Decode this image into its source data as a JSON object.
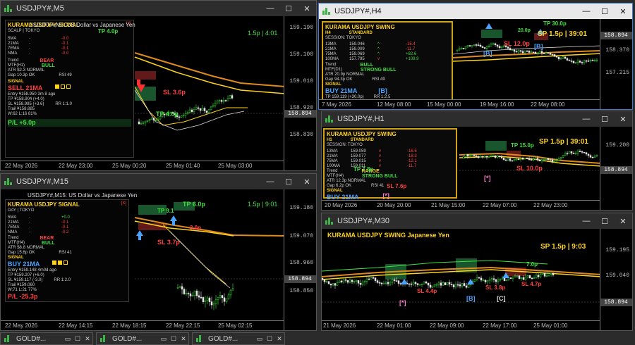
{
  "windows": {
    "m5": {
      "title": "USDJPY#,M5",
      "chart_desc": "USDJPY#,M5:  US Dollar vs Japanese Yen",
      "top_right": "1.5p | 4:01",
      "yticks": [
        "159.190",
        "159.100",
        "159.010",
        "158.920",
        "158.830"
      ],
      "price": "158.894",
      "xticks": [
        "22 May 2026",
        "22 May 23:00",
        "25 May 00:20",
        "25 May 01:40",
        "25 May 03:00"
      ],
      "panel": {
        "title": "KURAMA USDJPY SIGNAL",
        "close_mark": "[X]",
        "session": "SCALP | TOKYO",
        "ma_rows": [
          {
            "name": "5MA",
            "dash": "-",
            "value": "-0.0"
          },
          {
            "name": "21MA",
            "dash": "-",
            "value": "-0.1"
          },
          {
            "name": "7EMA",
            "dash": "-",
            "value": "-0.1"
          },
          {
            "name": "NMA",
            "dash": "-",
            "value": "-0.0"
          }
        ],
        "trend_label": "Trend",
        "trend_value": "BEAR",
        "mtf_label": "MTF(H1)",
        "mtf_value": "BULL",
        "atr": "ATR $2.3 NORMAL",
        "gap": "Gap 10.3p OK",
        "rsi": "RSI 49",
        "signal_label": "SIGNAL",
        "signal_value": "SELL  21MA",
        "entry": "Entry ¥158.950  3m 8 ago",
        "tp": "TP ¥158.904 (+4.0)",
        "sl": "SL ¥158.985 (+3.6)",
        "rr": "RR 1:1.0",
        "trail": "Trail ¥158.885",
        "winloss": "W:62 L:16  81%",
        "pl": "P/L  +5.0p"
      },
      "labels": {
        "tp_top": "TP 4.0p",
        "sl": "SL 3.6p",
        "tp_mid": "TP 4.0p"
      }
    },
    "m15": {
      "title": "USDJPY#,M15",
      "chart_desc": "USDJPY#,M15:  US Dollar vs Japanese Yen",
      "top_right": "1.5p | 9:01",
      "yticks": [
        "159.180",
        "159.070",
        "158.960",
        "158.850"
      ],
      "price": "158.894",
      "xticks": [
        "22 May 2026",
        "22 May 14:15",
        "22 May 18:15",
        "22 May 22:15",
        "25 May 02:15"
      ],
      "panel": {
        "title": "KURAMA USDJPY SIGNAL",
        "close_mark": "[X]",
        "session": "DAY | TOKYO",
        "ma_rows": [
          {
            "name": "5MA",
            "dash": "-",
            "value": "+0.0"
          },
          {
            "name": "21MA",
            "dash": "-",
            "value": "-0.1"
          },
          {
            "name": "7EMA",
            "dash": "-",
            "value": "-0.1"
          },
          {
            "name": "NMA",
            "dash": "-",
            "value": "-0.2"
          }
        ],
        "trend_label": "Trend",
        "trend_value": "BEAR",
        "mtf_label": "MTF(H4)",
        "mtf_value": "BULL",
        "atr": "ATR $8.8 NORMAL",
        "gap": "Gap 15.6p OK",
        "rsi": "RSI 41",
        "signal_label": "SIGNAL",
        "signal_value": "BUY  21MA",
        "entry": "Entry ¥159.148  4m0d ago",
        "tp": "TP ¥159.207 (+6.0)",
        "sl": "SL ¥159.117 (-3.0)",
        "rr": "RR 1:2.0",
        "trail": "Trail ¥159.060",
        "winloss": "W:71 L:21  77%",
        "pl": "P/L  -25.3p"
      },
      "labels": {
        "tp_top": "TP 6.0p",
        "tp_small": "TP 9.1",
        "sl": "SL 3.7p",
        "sl_small": "3.0p"
      }
    },
    "h4": {
      "title": "USDJPY#,H4",
      "top_right": "SP 1.5p  |  39:01",
      "yticks": [
        "158.370",
        "157.215"
      ],
      "price": "158.894",
      "xticks": [
        "7 May 2026",
        "12 May 08:00",
        "15 May 00:00",
        "19 May 16:00",
        "22 May 08:00"
      ],
      "panel": {
        "title": "KURAMA USDJPY SWING",
        "tf": "H4",
        "mode": "STANDARD",
        "session": "SESSION: TOKYO",
        "ma_rows": [
          {
            "name": "13MA",
            "price": "159.046",
            "arrow": "^",
            "value": "-15.4"
          },
          {
            "name": "21MA",
            "price": "159.009",
            "arrow": "^",
            "value": "-11.7"
          },
          {
            "name": "75MA",
            "price": "159.069",
            "arrow": "^",
            "value": "+82.6"
          },
          {
            "name": "100MA",
            "price": "157.795",
            "arrow": "v",
            "value": "+109.9"
          }
        ],
        "trend_label": "Trend",
        "trend_value": "BULL",
        "mtf_label": "MTF(D1)",
        "mtf_value": "STRONG BULL",
        "atr": "ATR 20.9p  NORMAL",
        "gap": "Gap 94.3p OK",
        "rsi": "RSI 49",
        "signal_label": "SIGNAL",
        "signal_value": "BUY  21MA",
        "signal_tag": "[B]",
        "entry": "TP 159.119 (+30.0p)",
        "rr": "RR 1:2.5"
      },
      "labels": {
        "tp": "TP 30.0p",
        "sl": "SL 12.0p",
        "tag1": "[B]",
        "tag2": "[B]",
        "small": "20.0p"
      }
    },
    "h1": {
      "title": "USDJPY#,H1",
      "top_right": "SP 1.5p  |  39:01",
      "yticks": [
        "159.200"
      ],
      "price": "158.894",
      "xticks": [
        "20 May 2026",
        "20 May 20:00",
        "21 May 15:00",
        "22 May 07:00",
        "22 May 23:00"
      ],
      "panel": {
        "title": "KURAMA USDJPY SWING",
        "tf": "H1",
        "mode": "STANDARD",
        "session": "SESSION: TOKYO",
        "ma_rows": [
          {
            "name": "13MA",
            "price": "159.059",
            "arrow": "v",
            "value": "-16.5"
          },
          {
            "name": "21MA",
            "price": "159.077",
            "arrow": "v",
            "value": "-18.3"
          },
          {
            "name": "75MA",
            "price": "159.015",
            "arrow": "v",
            "value": "-12.1"
          },
          {
            "name": "100MA",
            "price": "159.011",
            "arrow": "v",
            "value": "-11.7"
          }
        ],
        "trend_label": "Trend",
        "trend_value": "RANGE",
        "mtf_label": "MTF(H4)",
        "mtf_value": "STRONG BULL",
        "atr": "ATR 12.3p NORMAL",
        "gap": "Gap 6.2p OK",
        "rsi": "RSI 41",
        "signal_label": "SIGNAL",
        "signal_value": "BUY  21MA",
        "signal_tag": "[*]"
      },
      "labels": {
        "tp": "TP 15.0p",
        "sl": "SL 10.0p",
        "tag": "[*]",
        "small_tp": "TP 7.8p",
        "small_sl": "SL 7.6p"
      }
    },
    "m30": {
      "title": "USDJPY#,M30",
      "chart_desc": "KURAMA USDJPY SWING  Japanese Yen",
      "top_right": "SP 1.5p  |  9:03",
      "yticks": [
        "159.195",
        "159.040"
      ],
      "price": "158.894",
      "xticks": [
        "21 May 2026",
        "22 May 01:00",
        "22 May 09:00",
        "22 May 17:00",
        "25 May 01:00"
      ],
      "labels": {
        "sl1": "SL 4.4p",
        "sl2": "SL 3.8p",
        "sl3": "SL 4.7p",
        "tp": "7.0p",
        "tag1": "[*]",
        "tag2": "[B]",
        "tag3": "[C]"
      }
    }
  },
  "taskbar": {
    "tabs": [
      "GOLD#...",
      "GOLD#...",
      "GOLD#..."
    ]
  },
  "colors": {
    "bull": "#3ee03e",
    "bear": "#ff4040",
    "ma_orange": "#e08a1e",
    "ma_yellow": "#ffd21e",
    "accent_blue": "#4aa3ff"
  }
}
